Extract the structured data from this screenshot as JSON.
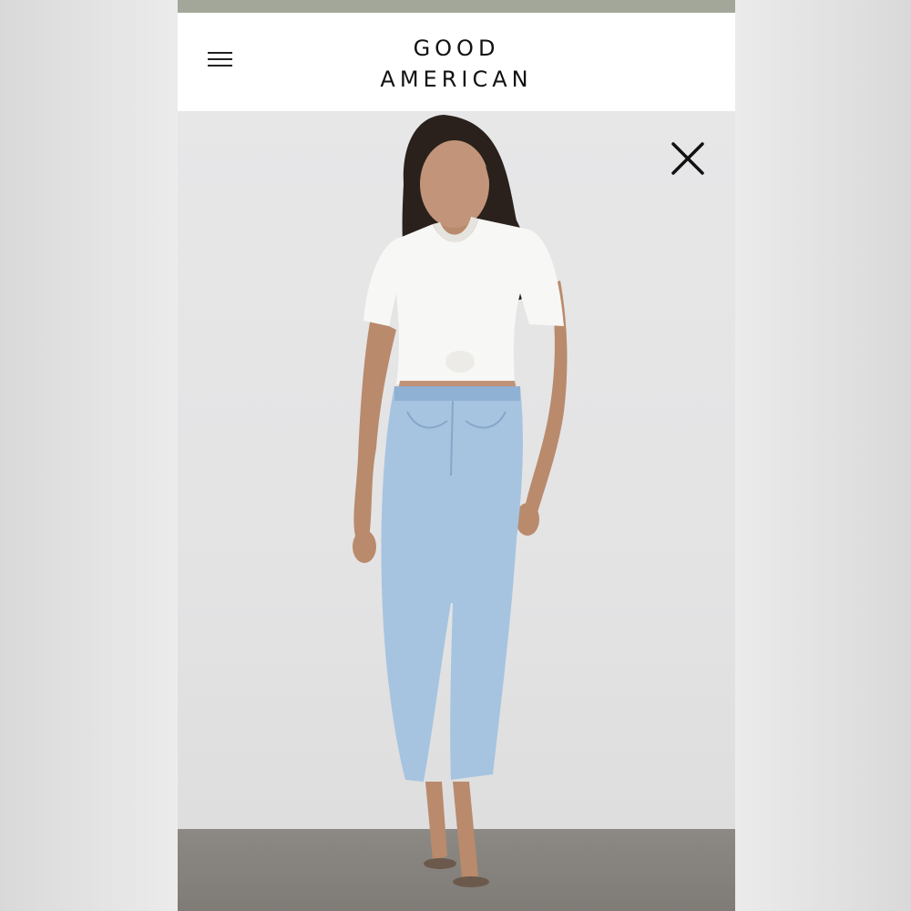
{
  "brand": {
    "line1": "GOOD",
    "line2": "AMERICAN"
  },
  "icons": {
    "menu": "hamburger-menu-icon",
    "close": "close-icon"
  },
  "colors": {
    "top_strip": "#a3a79a",
    "header_bg": "#ffffff",
    "logo_text": "#111111",
    "photo_bg": "#e5e5e6",
    "floor": "#85817c"
  }
}
